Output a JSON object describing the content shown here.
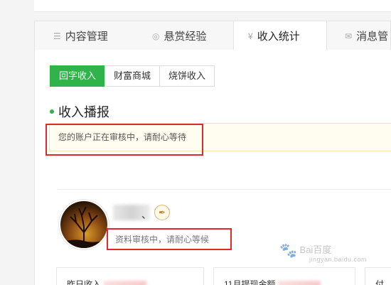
{
  "tabs": [
    {
      "label": "内容管理",
      "icon": "list-icon"
    },
    {
      "label": "悬赏经验",
      "icon": "coin-icon"
    },
    {
      "label": "收入统计",
      "icon": "yen-icon",
      "active": true
    },
    {
      "label": "消息管",
      "icon": "mail-icon"
    }
  ],
  "subtabs": [
    {
      "label": "回字收入",
      "active": true
    },
    {
      "label": "财富商城"
    },
    {
      "label": "烧饼收入"
    }
  ],
  "section": {
    "title": "收入播报"
  },
  "notice": {
    "text": "您的账户正在审核中，请耐心等待"
  },
  "profile": {
    "name_visible_char": "、",
    "badge_icon": "pen-nib-badge-icon",
    "review_text": "资料审核中，请耐心等候"
  },
  "stats": [
    {
      "label": "昨日收入"
    },
    {
      "label": "11月提现金额"
    },
    {
      "label": "付"
    }
  ],
  "watermark": {
    "text": "Bai百度",
    "sub": "jingyan.baidu.com"
  },
  "colors": {
    "accent_green": "#2fb34a",
    "highlight_red": "#e02a2a",
    "notice_bg": "#fffdf0"
  }
}
